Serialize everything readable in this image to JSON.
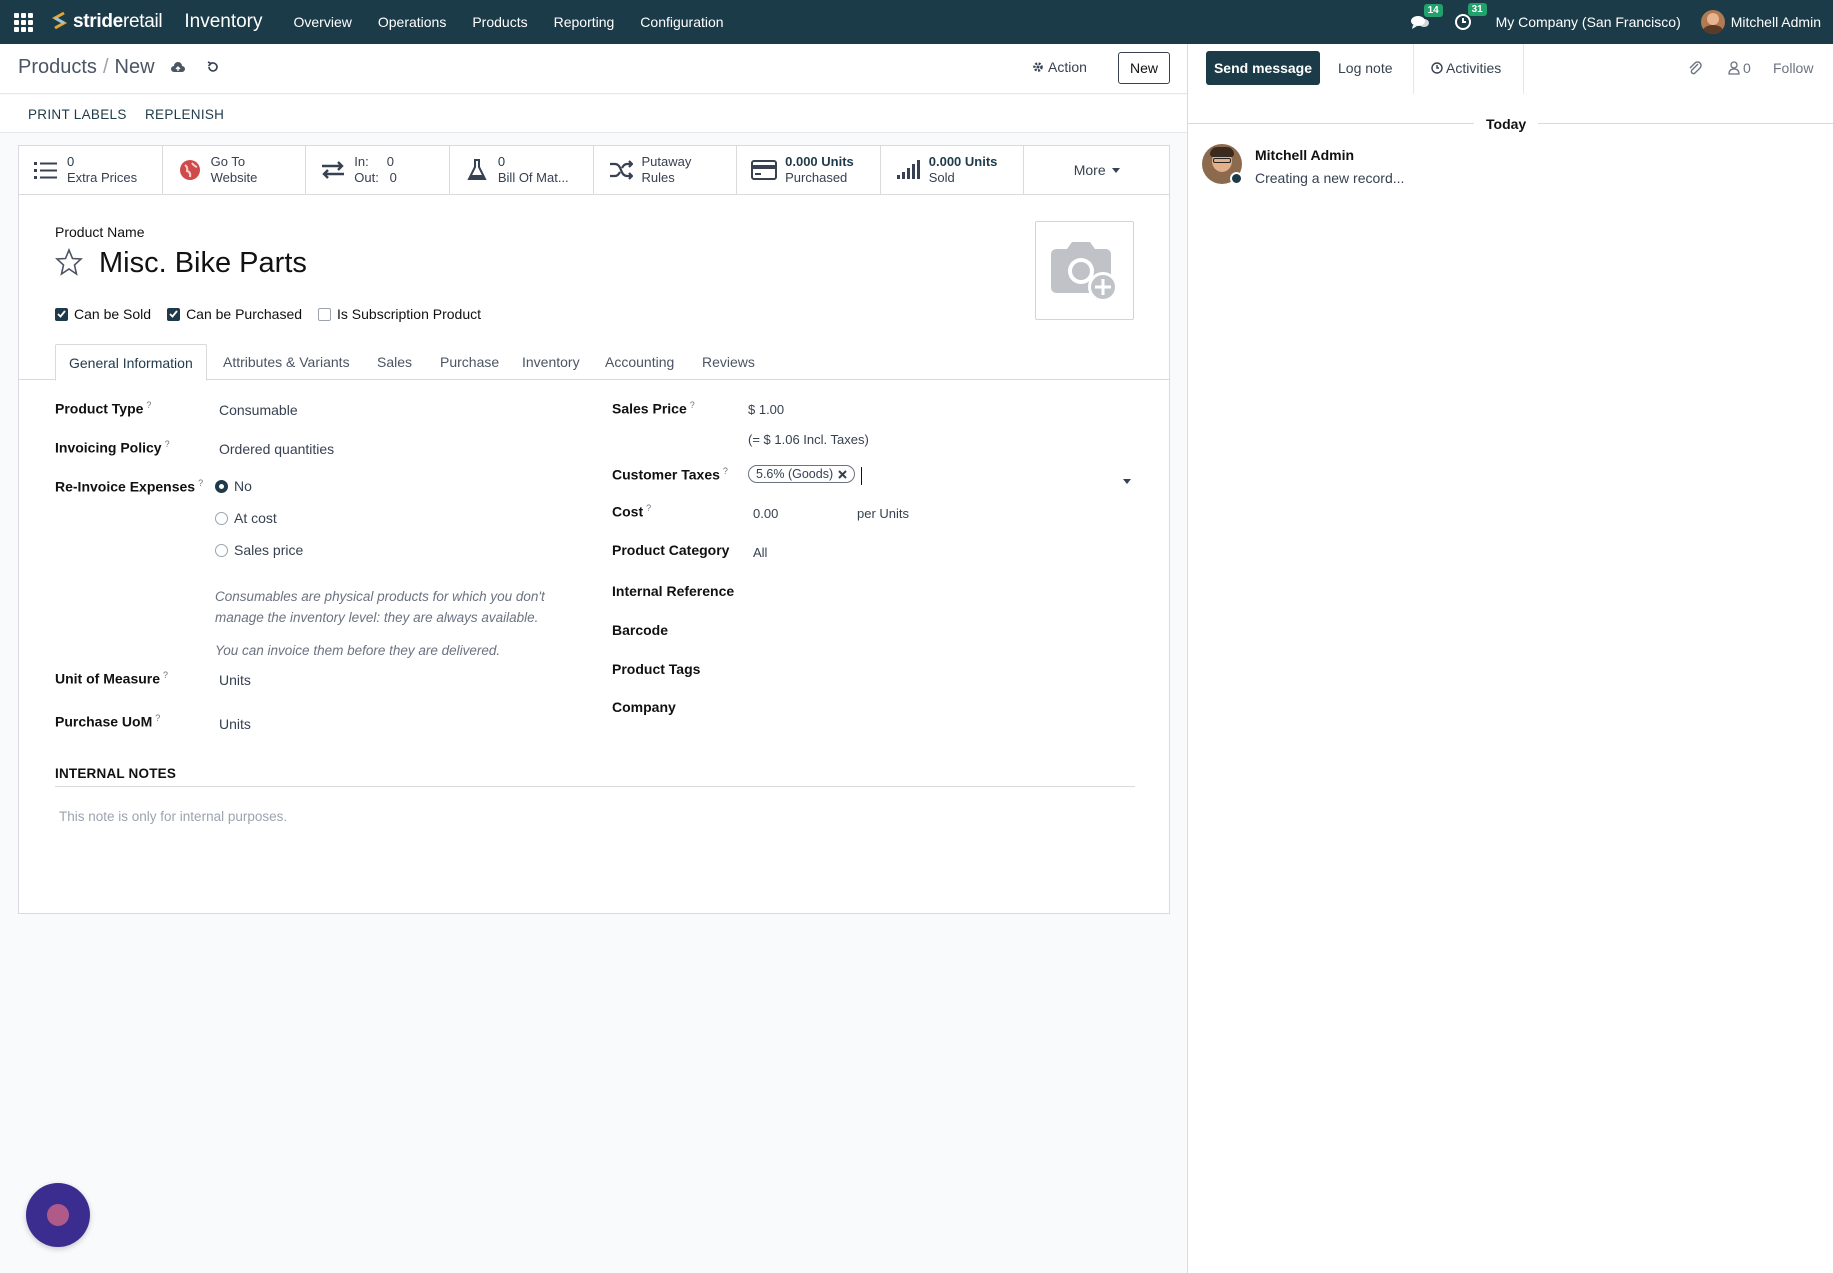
{
  "topbar": {
    "brand_stride": "stride",
    "brand_retail": "retail",
    "app_name": "Inventory",
    "menu": [
      "Overview",
      "Operations",
      "Products",
      "Reporting",
      "Configuration"
    ],
    "messages_badge": "14",
    "activities_badge": "31",
    "company": "My Company (San Francisco)",
    "user": "Mitchell Admin"
  },
  "control_panel": {
    "breadcrumb_parent": "Products",
    "breadcrumb_sep": "/",
    "breadcrumb_current": "New",
    "action_label": "Action",
    "new_label": "New",
    "print_labels": "PRINT LABELS",
    "replenish": "REPLENISH"
  },
  "stats": [
    {
      "icon": "list-icon",
      "line1": "0",
      "line2": "Extra Prices"
    },
    {
      "icon": "globe-icon",
      "line1": "Go To",
      "line2": "Website"
    },
    {
      "icon": "arrows-icon",
      "line1": "In:     0",
      "line2": "Out:   0"
    },
    {
      "icon": "flask-icon",
      "line1": "0",
      "line2": "Bill Of Mat..."
    },
    {
      "icon": "shuffle-icon",
      "line1": "Putaway",
      "line2": "Rules"
    },
    {
      "icon": "credit-card-icon",
      "line1": "0.000 Units",
      "line2": "Purchased"
    },
    {
      "icon": "bar-signal-icon",
      "line1": "0.000 Units",
      "line2": "Sold"
    }
  ],
  "stats_more": "More",
  "form": {
    "product_name_label": "Product Name",
    "product_name": "Misc. Bike Parts",
    "can_be_sold": "Can be Sold",
    "can_be_purchased": "Can be Purchased",
    "is_subscription": "Is Subscription Product",
    "tabs": [
      "General Information",
      "Attributes & Variants",
      "Sales",
      "Purchase",
      "Inventory",
      "Accounting",
      "Reviews"
    ],
    "product_type_label": "Product Type",
    "product_type": "Consumable",
    "invoicing_policy_label": "Invoicing Policy",
    "invoicing_policy": "Ordered quantities",
    "reinvoice_label": "Re-Invoice Expenses",
    "reinvoice_options": [
      "No",
      "At cost",
      "Sales price"
    ],
    "help_1": "Consumables are physical products for which you don't",
    "help_2": "manage the inventory level: they are always available.",
    "help_3": "You can invoice them before they are delivered.",
    "uom_label": "Unit of Measure",
    "uom": "Units",
    "purchase_uom_label": "Purchase UoM",
    "purchase_uom": "Units",
    "sales_price_label": "Sales Price",
    "sales_price": "$ 1.00",
    "incl_taxes": "(= $ 1.06 Incl. Taxes)",
    "customer_taxes_label": "Customer Taxes",
    "customer_tax_tag": "5.6% (Goods)",
    "cost_label": "Cost",
    "cost": "0.00",
    "cost_unit": "per Units",
    "product_category_label": "Product Category",
    "product_category": "All",
    "internal_reference_label": "Internal Reference",
    "barcode_label": "Barcode",
    "product_tags_label": "Product Tags",
    "company_label": "Company",
    "help_mark": "?",
    "internal_notes_title": "INTERNAL NOTES",
    "internal_notes_placeholder": "This note is only for internal purposes."
  },
  "chatter": {
    "send_message": "Send message",
    "log_note": "Log note",
    "activities": "Activities",
    "followers_count": "0",
    "follow": "Follow",
    "today": "Today",
    "message_author": "Mitchell Admin",
    "message_text": "Creating a new record..."
  },
  "colors": {
    "topbar": "#1c3b48",
    "accent": "#1f3a4a",
    "badge": "#21a16b"
  }
}
